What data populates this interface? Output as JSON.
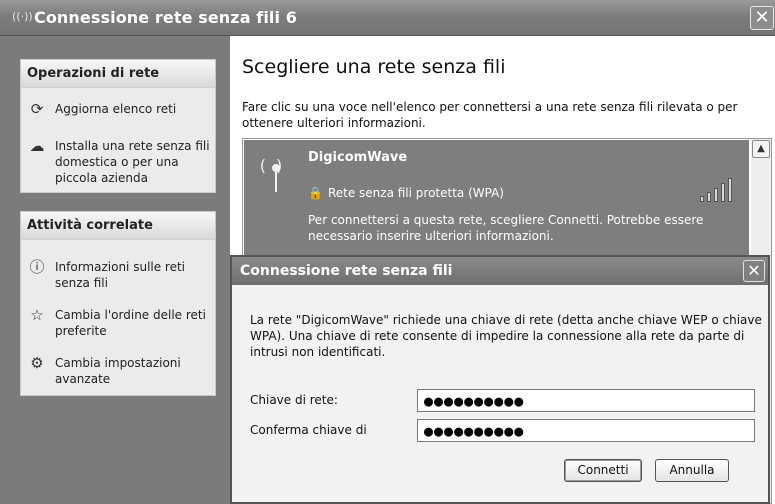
{
  "window": {
    "title": "Connessione rete senza fili 6",
    "close_label": "✕",
    "title_icon": "((·))"
  },
  "sidebar": {
    "network_ops": {
      "header": "Operazioni di rete",
      "items": [
        {
          "icon": "refresh-icon",
          "glyph": "⟳",
          "label": "Aggiorna elenco reti"
        },
        {
          "icon": "setup-wizard-icon",
          "glyph": "☁",
          "label": "Installa una rete senza fili domestica o per una piccola azienda"
        }
      ]
    },
    "related_tasks": {
      "header": "Attività correlate",
      "items": [
        {
          "icon": "info-icon",
          "glyph": "ⓘ",
          "label": "Informazioni sulle reti senza fili"
        },
        {
          "icon": "star-icon",
          "glyph": "☆",
          "label": "Cambia l'ordine delle reti preferite"
        },
        {
          "icon": "settings-icon",
          "glyph": "⚙",
          "label": "Cambia impostazioni avanzate"
        }
      ]
    }
  },
  "main": {
    "title": "Scegliere una rete senza fili",
    "description": "Fare clic su una voce nell'elenco per connettersi a una rete senza fili rilevata o per ottenere ulteriori informazioni.",
    "networks": [
      {
        "name": "DigicomWave",
        "security": "Rete senza fili protetta (WPA)",
        "signal_strength": 5,
        "info": "Per connettersi a questa rete, scegliere Connetti. Potrebbe essere necessario inserire ulteriori informazioni."
      }
    ],
    "scroll_up_glyph": "▲"
  },
  "dialog": {
    "title": "Connessione rete senza fili",
    "close_label": "✕",
    "message": "La rete \"DigicomWave\" richiede una chiave di rete (detta anche chiave WEP o chiave WPA). Una chiave di rete consente di impedire la connessione alla rete da parte di intrusi non identificati.",
    "key_label": "Chiave di rete:",
    "key_value": "●●●●●●●●●●",
    "confirm_label": "Conferma chiave di",
    "confirm_value": "●●●●●●●●●●",
    "connect_label": "Connetti",
    "cancel_label": "Annulla"
  }
}
